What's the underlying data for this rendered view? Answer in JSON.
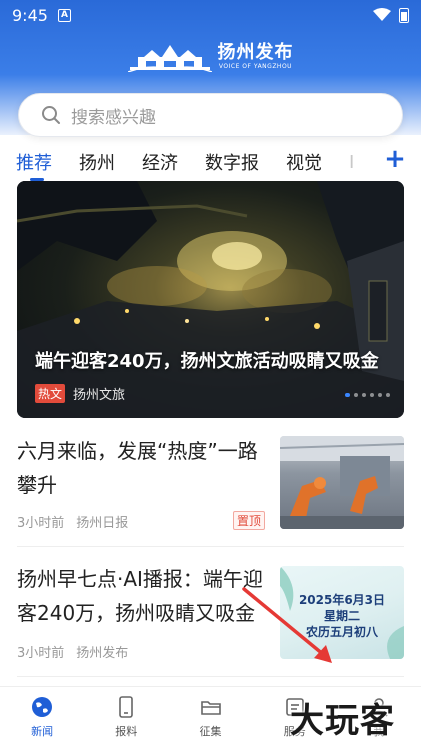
{
  "status_bar": {
    "time": "9:45",
    "notif_icon": "A"
  },
  "header": {
    "app_name": "扬州发布",
    "app_sub": "VOICE OF YANGZHOU"
  },
  "search": {
    "placeholder": "搜索感兴趣"
  },
  "tabs": [
    {
      "label": "推荐",
      "active": true
    },
    {
      "label": "扬州"
    },
    {
      "label": "经济"
    },
    {
      "label": "数字报"
    },
    {
      "label": "视觉"
    },
    {
      "label": "I"
    }
  ],
  "add_tab_label": "+",
  "banner": {
    "title": "端午迎客240万，扬州文旅活动吸睛又吸金",
    "tag": "热文",
    "source": "扬州文旅"
  },
  "news": [
    {
      "title": "六月来临，发展“热度”一路攀升",
      "time": "3小时前",
      "source": "扬州日报",
      "tag": "置顶"
    },
    {
      "title": "扬州早七点·AI播报：端午迎客240万，扬州吸睛又吸金",
      "time": "3小时前",
      "source": "扬州发布",
      "thumb_text": [
        "2025年6月3日",
        "星期二",
        "农历五月初八"
      ]
    }
  ],
  "bottom_nav": [
    {
      "label": "新闻",
      "icon": "globe-icon",
      "active": true
    },
    {
      "label": "报料",
      "icon": "phone-icon"
    },
    {
      "label": "征集",
      "icon": "folder-icon"
    },
    {
      "label": "服务",
      "icon": "service-icon"
    },
    {
      "label": "我",
      "icon": "user-icon"
    }
  ],
  "watermark": "大玩客",
  "colors": {
    "accent": "#1f5ed6",
    "hot_tag": "#e24b3b",
    "header_blue": "#2a6ad8",
    "arrow_red": "#e53935"
  }
}
